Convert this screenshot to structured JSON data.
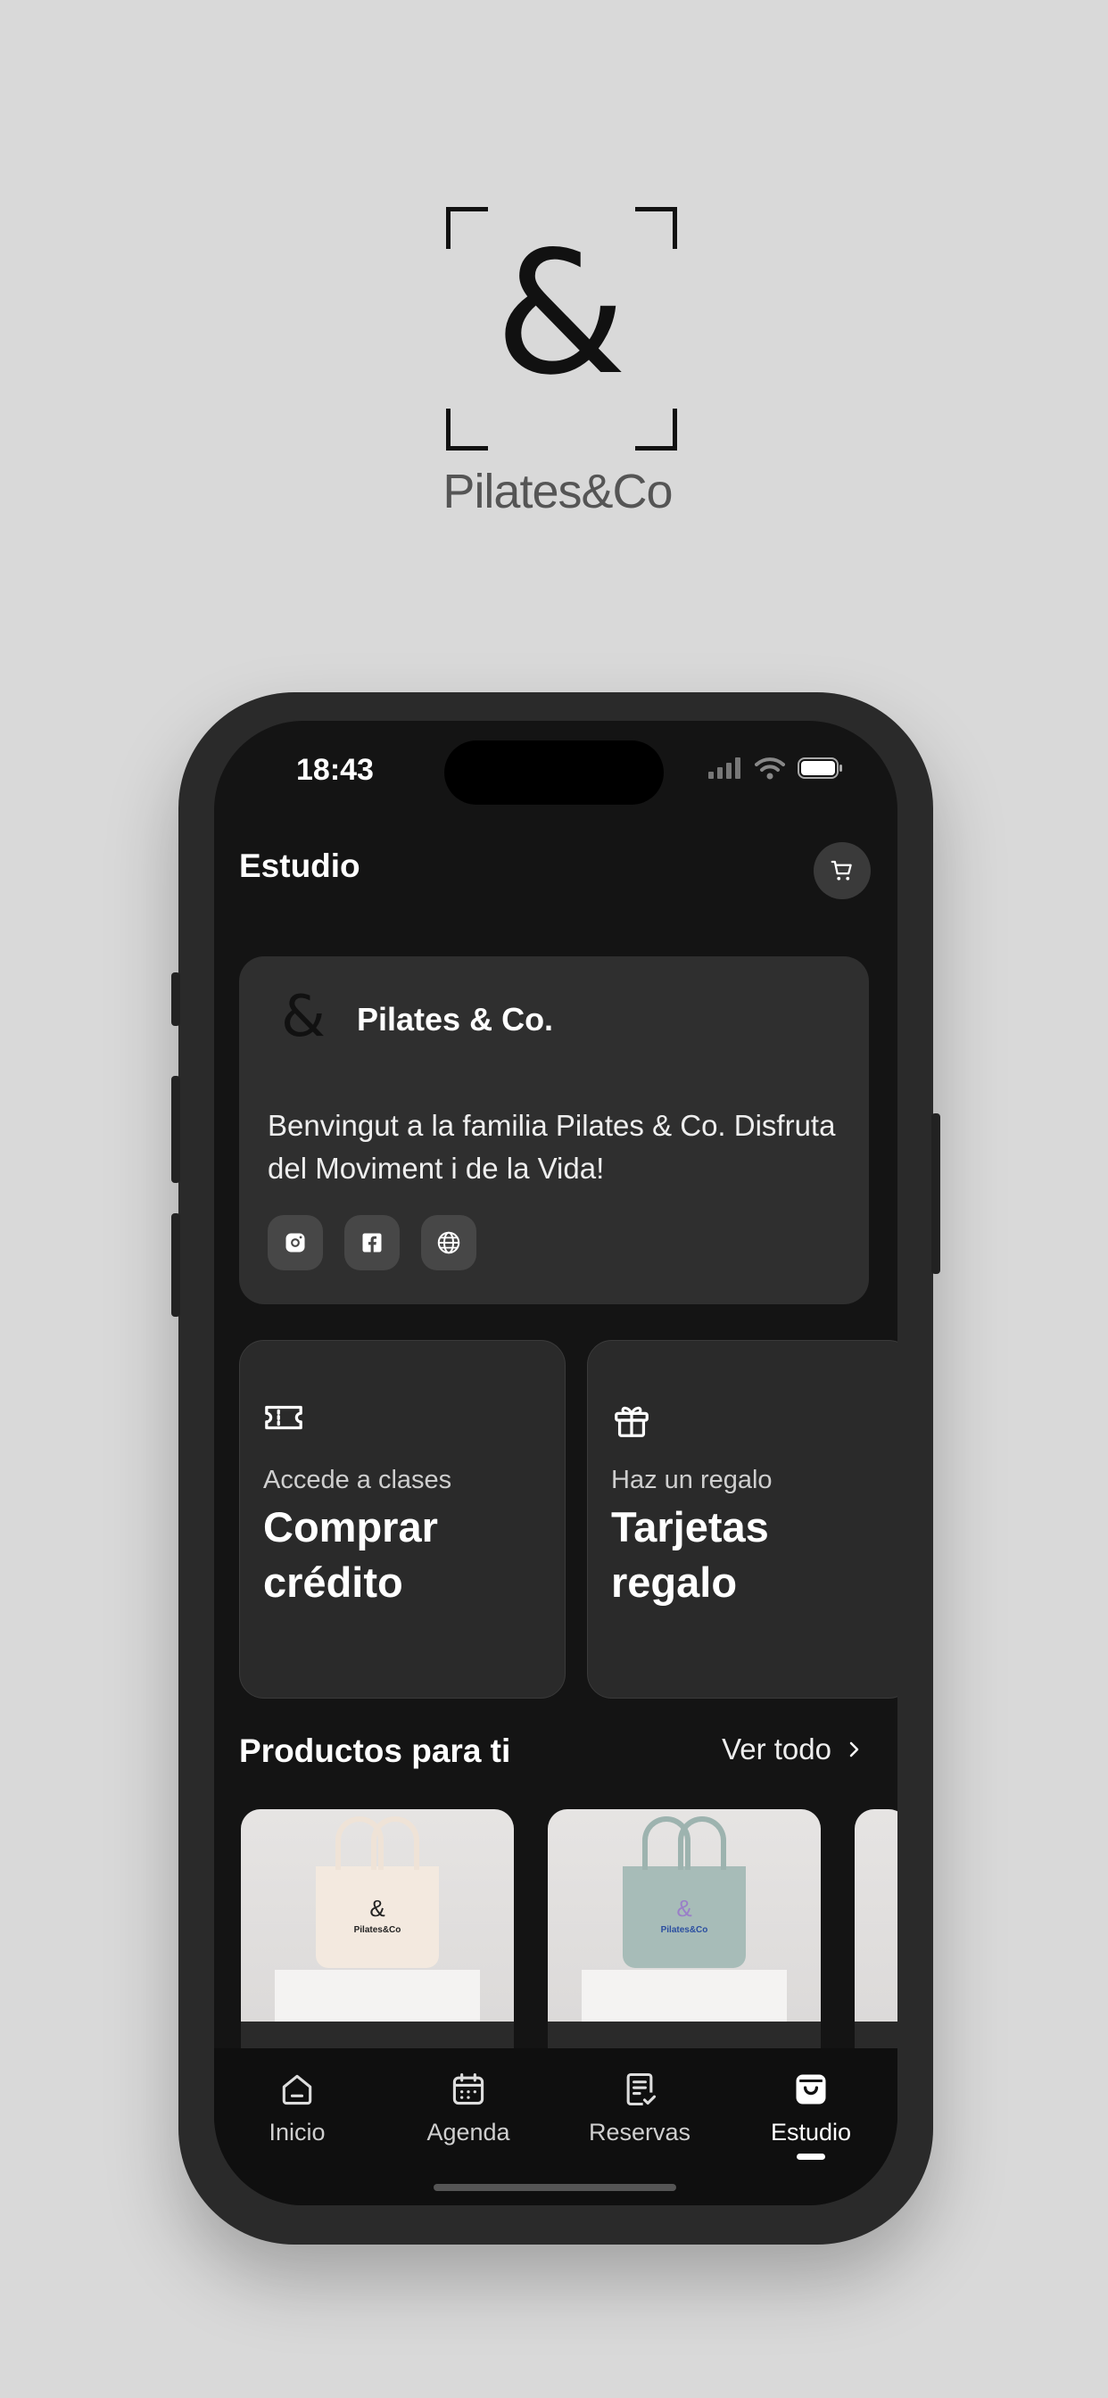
{
  "brand": {
    "mark": "&",
    "wordmark": "Pilates&Co"
  },
  "status": {
    "time": "18:43"
  },
  "header": {
    "title": "Estudio"
  },
  "studio": {
    "logo_mark": "&",
    "name": "Pilates & Co.",
    "description": "Benvingut a la familia Pilates & Co. Disfruta del Moviment i de la Vida!",
    "socials": [
      "instagram-icon",
      "facebook-icon",
      "globe-icon"
    ]
  },
  "actions": [
    {
      "subtitle": "Accede a clases",
      "title": "Comprar crédito",
      "icon": "ticket-icon"
    },
    {
      "subtitle": "Haz un regalo",
      "title": "Tarjetas regalo",
      "icon": "gift-icon"
    }
  ],
  "products_section": {
    "title": "Productos para ti",
    "see_all": "Ver todo"
  },
  "products": [
    {
      "mark": "&",
      "label": "Pilates&Co",
      "bag_color": "#f3e9df"
    },
    {
      "mark": "&",
      "label": "Pilates&Co",
      "bag_color": "#a7bcb8"
    }
  ],
  "tabs": [
    {
      "label": "Inicio",
      "icon": "home-icon",
      "active": false
    },
    {
      "label": "Agenda",
      "icon": "calendar-icon",
      "active": false
    },
    {
      "label": "Reservas",
      "icon": "reservations-icon",
      "active": false
    },
    {
      "label": "Estudio",
      "icon": "shopping-bag-icon",
      "active": true
    }
  ]
}
